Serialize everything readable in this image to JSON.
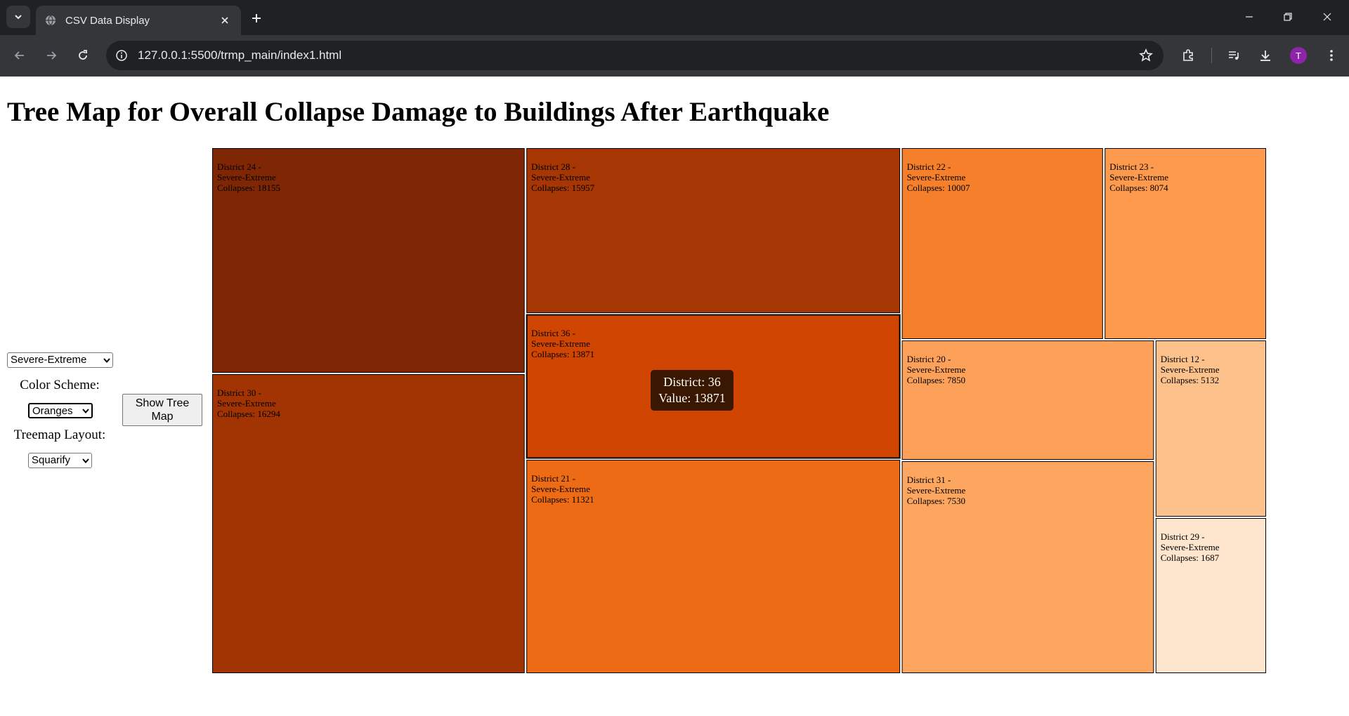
{
  "browser": {
    "tab_title": "CSV Data Display",
    "url": "127.0.0.1:5500/trmp_main/index1.html",
    "avatar_letter": "T"
  },
  "page": {
    "title": "Tree Map for Overall Collapse Damage to Buildings After Earthquake"
  },
  "controls": {
    "metric_value": "Severe-Extreme",
    "color_scheme_label": "Color Scheme:",
    "color_scheme_value": "Oranges",
    "layout_label": "Treemap Layout:",
    "layout_value": "Squarify",
    "show_button_label": "Show Tree Map"
  },
  "tooltip": {
    "line1": "District: 36",
    "line2": "Value: 13871"
  },
  "chart_data": {
    "type": "treemap",
    "category_label": "Severe-Extreme",
    "color_scheme": "Oranges",
    "items": [
      {
        "district": "District 24",
        "category": "Severe-Extreme",
        "value": 18155,
        "color": "#7f2704"
      },
      {
        "district": "District 30",
        "category": "Severe-Extreme",
        "value": 16294,
        "color": "#a23403"
      },
      {
        "district": "District 28",
        "category": "Severe-Extreme",
        "value": 15957,
        "color": "#a63603"
      },
      {
        "district": "District 36",
        "category": "Severe-Extreme",
        "value": 13871,
        "color": "#d04501"
      },
      {
        "district": "District 21",
        "category": "Severe-Extreme",
        "value": 11321,
        "color": "#ee6b16"
      },
      {
        "district": "District 22",
        "category": "Severe-Extreme",
        "value": 10007,
        "color": "#f67f2c"
      },
      {
        "district": "District 23",
        "category": "Severe-Extreme",
        "value": 8074,
        "color": "#fd9a4e"
      },
      {
        "district": "District 20",
        "category": "Severe-Extreme",
        "value": 7850,
        "color": "#fda05a"
      },
      {
        "district": "District 31",
        "category": "Severe-Extreme",
        "value": 7530,
        "color": "#fda660"
      },
      {
        "district": "District 12",
        "category": "Severe-Extreme",
        "value": 5132,
        "color": "#fdc28c"
      },
      {
        "district": "District 29",
        "category": "Severe-Extreme",
        "value": 1687,
        "color": "#fee6ce"
      }
    ],
    "highlighted": "District 36"
  }
}
